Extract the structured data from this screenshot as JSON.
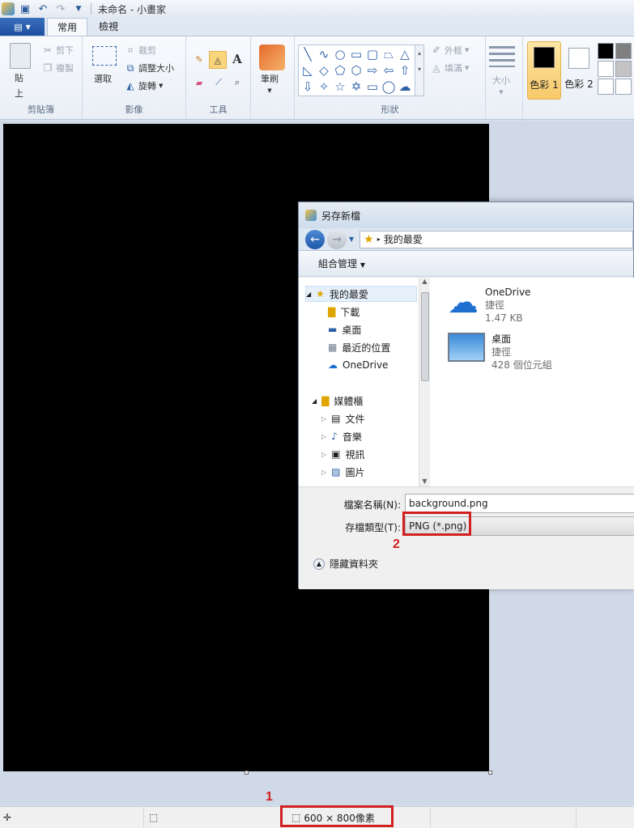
{
  "window": {
    "title": "未命名 - 小畫家"
  },
  "tabs": [
    {
      "label": "常用"
    },
    {
      "label": "檢視"
    }
  ],
  "ribbon": {
    "clipboard": {
      "paste_label": "貼\n上",
      "paste_l1": "貼",
      "paste_l2": "上",
      "cut": "剪下",
      "copy": "複製",
      "group": "剪貼簿"
    },
    "image": {
      "select": "選取",
      "crop": "裁剪",
      "resize": "調整大小",
      "rotate": "旋轉",
      "group": "影像"
    },
    "tools": {
      "group": "工具"
    },
    "brushes": {
      "label": "筆刷"
    },
    "shapes": {
      "outline": "外框",
      "fill": "填滿",
      "group": "形狀"
    },
    "size": {
      "label": "大小"
    },
    "color1": {
      "label": "色彩 1"
    },
    "color2": {
      "label": "色彩 2"
    }
  },
  "colors": {
    "accent": "#f8c96a",
    "canvas": "#000000",
    "highlight": "#d21f1f"
  },
  "statusbar": {
    "canvas_size": "600 × 800像素"
  },
  "callouts": {
    "one": "1",
    "two": "2"
  },
  "dialog": {
    "title": "另存新檔",
    "address": "我的最愛",
    "organize": "組合管理",
    "tree": [
      {
        "label": "我的最愛"
      },
      {
        "label": "下載"
      },
      {
        "label": "桌面"
      },
      {
        "label": "最近的位置"
      },
      {
        "label": "OneDrive"
      },
      {
        "label": "媒體櫃"
      },
      {
        "label": "文件"
      },
      {
        "label": "音樂"
      },
      {
        "label": "視訊"
      },
      {
        "label": "圖片"
      }
    ],
    "files": [
      {
        "name": "OneDrive",
        "type": "捷徑",
        "size": "1.47 KB"
      },
      {
        "name": "桌面",
        "type": "捷徑",
        "size": "428 個位元組"
      }
    ],
    "filename_label": "檔案名稱(N):",
    "filename_value": "background.png",
    "filetype_label": "存檔類型(T):",
    "filetype_value": "PNG (*.png)",
    "hide_folders": "隱藏資料夾"
  }
}
